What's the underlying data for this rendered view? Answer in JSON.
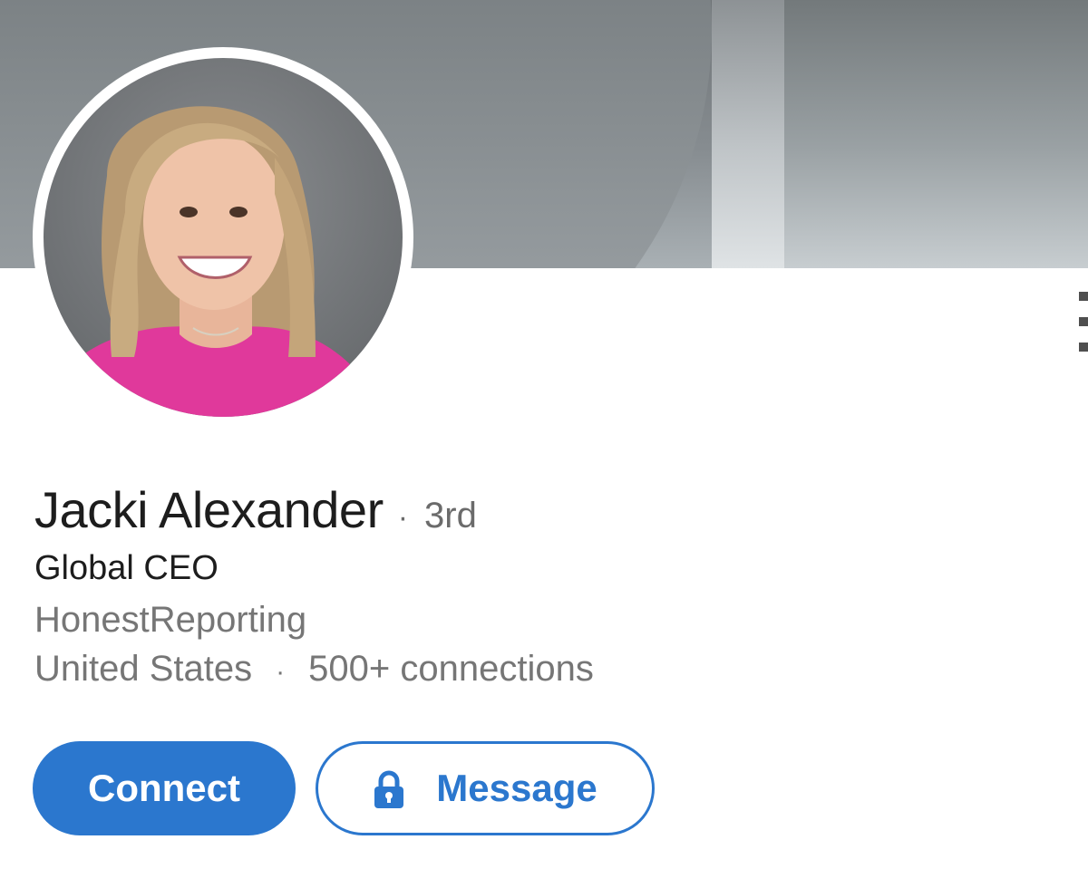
{
  "profile": {
    "name": "Jacki Alexander",
    "degree_separator": "·",
    "degree": "3rd",
    "headline": "Global CEO",
    "company": "HonestReporting",
    "location": "United States",
    "meta_separator": "·",
    "connections": "500+ connections"
  },
  "actions": {
    "connect_label": "Connect",
    "message_label": "Message"
  },
  "icons": {
    "message_icon": "lock-icon",
    "overflow_icon": "more-vertical-icon"
  },
  "colors": {
    "accent": "#2b77ce",
    "primary_text": "#1d1d1d",
    "secondary_text": "#767676"
  }
}
